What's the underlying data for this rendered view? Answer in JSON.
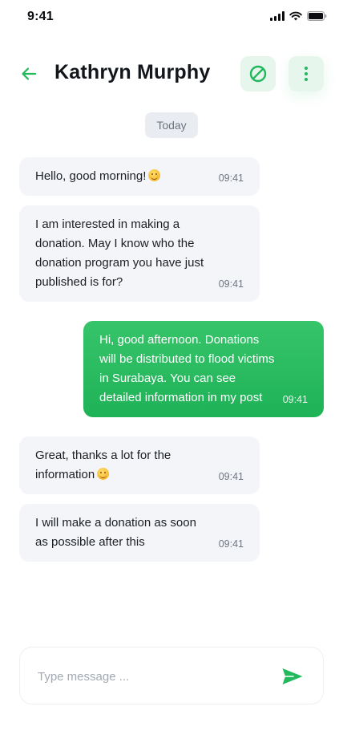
{
  "status_bar": {
    "time": "9:41"
  },
  "header": {
    "contact_name": "Kathryn Murphy"
  },
  "date_label": "Today",
  "messages": [
    {
      "direction": "in",
      "text": "Hello, good morning!",
      "emoji": "smiling-face",
      "time": "09:41"
    },
    {
      "direction": "in",
      "text": "I am interested in making a donation. May I know who the donation program you have just published is for?",
      "time": "09:41"
    },
    {
      "direction": "out",
      "text": "Hi, good afternoon. Donations will be distributed to flood victims in Surabaya. You can see detailed information in my post",
      "time": "09:41"
    },
    {
      "direction": "in",
      "text": "Great, thanks a lot for the information",
      "emoji": "grinning-face",
      "time": "09:41"
    },
    {
      "direction": "in",
      "text": "I will make a donation as soon as possible after this",
      "time": "09:41"
    }
  ],
  "composer": {
    "placeholder": "Type message ..."
  },
  "colors": {
    "accent": "#20b85b",
    "accent_soft": "#e6f6ec",
    "incoming_bubble": "#f4f5f8"
  },
  "icons": {
    "back": "arrow-left-icon",
    "block": "block-icon",
    "more": "more-vertical-icon",
    "send": "send-icon"
  }
}
